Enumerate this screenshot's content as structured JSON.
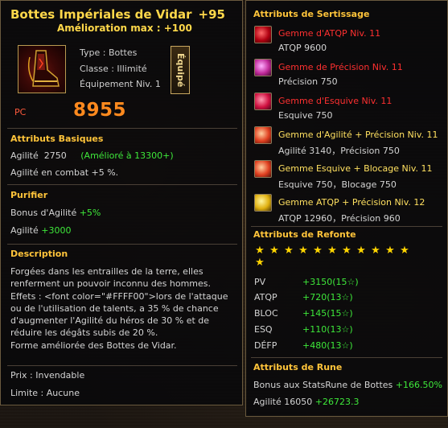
{
  "item": {
    "name": "Bottes Impériales de Vidar",
    "enhance": "+95",
    "max_enhance": "Amélioration max : +100",
    "type": "Type : Bottes",
    "class": "Classe : Illimité",
    "equip_level": "Équipement Niv. 1",
    "equipped_button": "Équipé",
    "pc_label": "PC",
    "pc_value": "8955"
  },
  "basic": {
    "title": "Attributs Basiques",
    "agility_label": "Agilité",
    "agility_value": "2750",
    "agility_upgrade": "(Amélioré à 13300+)",
    "combat_agility": "Agilité en combat +5 %."
  },
  "purify": {
    "title": "Purifier",
    "bonus_label": "Bonus d'Agilité",
    "bonus_value": "+5%",
    "agility_label": "Agilité",
    "agility_value": "+3000"
  },
  "description": {
    "title": "Description",
    "text": "Forgées dans les entrailles de la terre, elles renferment un pouvoir inconnu des hommes. Effets : <font color=\"#FFFF00\">lors de l'attaque ou de l'utilisation de talents, a 35 % de chance d'augmenter l'Agilité du héros de 30 % et de réduire les dégâts subis de 20 %.",
    "text2": "Forme améliorée des Bottes de Vidar."
  },
  "price": "Prix : Invendable",
  "limit": "Limite : Aucune",
  "sockets": {
    "title": "Attributs de Sertissage",
    "gems": [
      {
        "name": "Gemme d'ATQP Niv. 11",
        "value": "ATQP 9600"
      },
      {
        "name": "Gemme de Précision Niv. 11",
        "value": "Précision 750"
      },
      {
        "name": "Gemme d'Esquive Niv. 11",
        "value": "Esquive 750"
      },
      {
        "name": "Gemme d'Agilité + Précision Niv. 11",
        "value": "Agilité 3140，Précision 750"
      },
      {
        "name": "Gemme Esquive + Blocage Niv. 11",
        "value": "Esquive 750，Blocage 750"
      },
      {
        "name": "Gemme ATQP + Précision Niv. 12",
        "value": "ATQP 12960，Précision 960"
      }
    ]
  },
  "refonte": {
    "title": "Attributs de Refonte",
    "star_count": 12,
    "star_glyph": "★",
    "stats": [
      {
        "label": "PV",
        "value": "+3150(15☆)"
      },
      {
        "label": "ATQP",
        "value": "+720(13☆)"
      },
      {
        "label": "BLOC",
        "value": "+145(15☆)"
      },
      {
        "label": "ESQ",
        "value": "+110(13☆)"
      },
      {
        "label": "DÉFP",
        "value": "+480(13☆)"
      }
    ]
  },
  "rune": {
    "title": "Attributs de Rune",
    "bonus_label": "Bonus aux StatsRune de Bottes",
    "bonus_value": "+166.50%",
    "agility_label": "Agilité 16050",
    "agility_value": "+26723.3"
  },
  "colors": {
    "gold": "#ffc43a",
    "green": "#3ee83a",
    "red": "#ff3030",
    "pc_orange": "#ff8a1e"
  }
}
